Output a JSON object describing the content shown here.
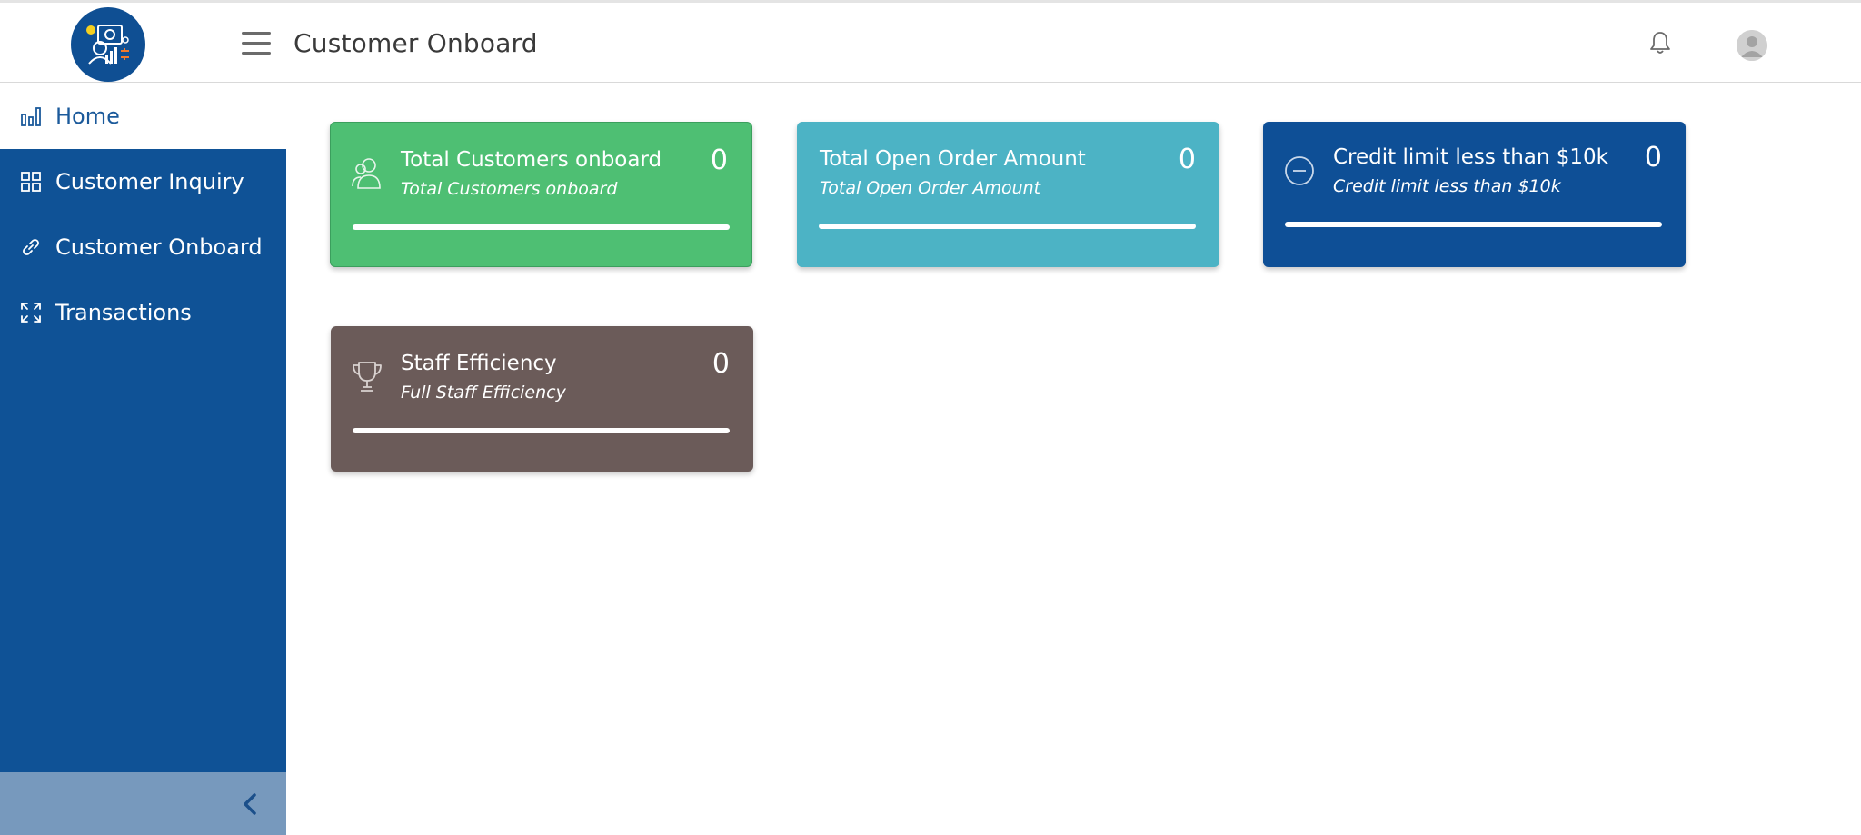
{
  "header": {
    "title": "Customer Onboard"
  },
  "sidebar": {
    "items": [
      {
        "label": "Home",
        "icon": "bar-chart-icon",
        "active": true
      },
      {
        "label": "Customer Inquiry",
        "icon": "grid-icon",
        "active": false
      },
      {
        "label": "Customer Onboard",
        "icon": "link-icon",
        "active": false
      },
      {
        "label": "Transactions",
        "icon": "expand-icon",
        "active": false
      }
    ]
  },
  "cards": [
    {
      "title": "Total Customers onboard",
      "subtitle": "Total Customers onboard",
      "value": "0",
      "icon": "users-icon",
      "color": "#4ebf73"
    },
    {
      "title": "Total Open Order Amount",
      "subtitle": "Total Open Order Amount",
      "value": "0",
      "icon": "none",
      "color": "#4cb3c5"
    },
    {
      "title": "Credit limit less than $10k",
      "subtitle": "Credit limit less than $10k",
      "value": "0",
      "icon": "minus-circle-icon",
      "color": "#0e4f96"
    },
    {
      "title": "Staff Efficiency",
      "subtitle": "Full Staff Efficiency",
      "value": "0",
      "icon": "trophy-icon",
      "color": "#6b5b59"
    }
  ],
  "colors": {
    "sidebar": "#0f5296",
    "collapse_bar": "#7799bd",
    "accent": "#1b5a9b"
  }
}
